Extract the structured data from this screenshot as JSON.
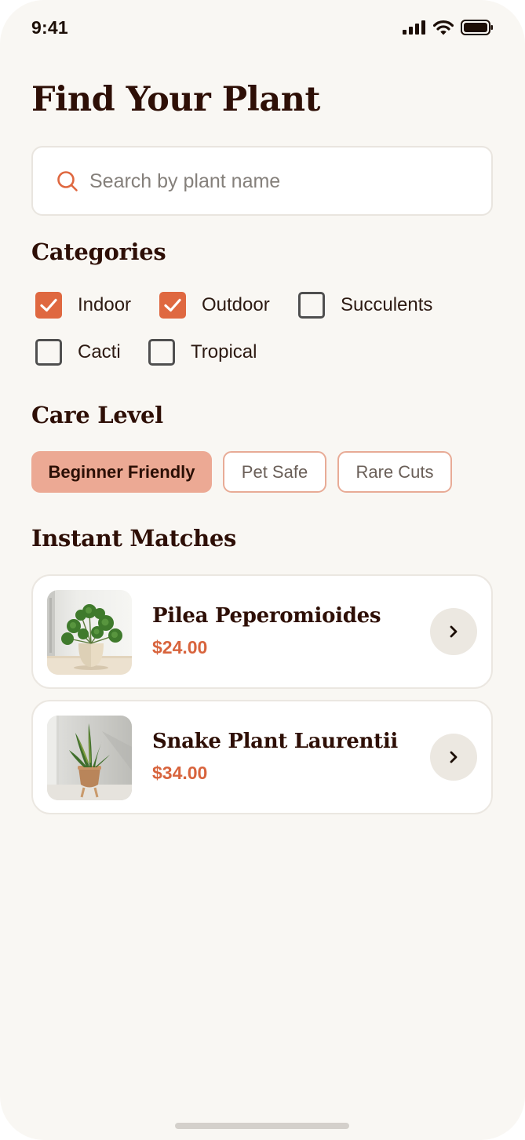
{
  "status_bar": {
    "time": "9:41",
    "icons": [
      "cellular-signal-icon",
      "wifi-icon",
      "battery-icon"
    ]
  },
  "header": {
    "title": "Find Your Plant"
  },
  "search": {
    "placeholder": "Search by plant name",
    "value": "",
    "icon": "search-icon"
  },
  "categories": {
    "title": "Categories",
    "items": [
      {
        "label": "Indoor",
        "checked": true
      },
      {
        "label": "Outdoor",
        "checked": true
      },
      {
        "label": "Succulents",
        "checked": false
      },
      {
        "label": "Cacti",
        "checked": false
      },
      {
        "label": "Tropical",
        "checked": false
      }
    ]
  },
  "care_level": {
    "title": "Care Level",
    "chips": [
      {
        "label": "Beginner Friendly",
        "active": true
      },
      {
        "label": "Pet Safe",
        "active": false
      },
      {
        "label": "Rare Cuts",
        "active": false
      }
    ]
  },
  "matches": {
    "title": "Instant Matches",
    "items": [
      {
        "name": "Pilea Peperomioides",
        "price": "$24.00",
        "icon": "chevron-right-icon"
      },
      {
        "name": "Snake Plant Laurentii",
        "price": "$34.00",
        "icon": "chevron-right-icon"
      }
    ]
  },
  "colors": {
    "background": "#f9f7f3",
    "accent": "#df6840",
    "price": "#d8643d",
    "chip_active": "#eca994",
    "title": "#2e0f06"
  }
}
